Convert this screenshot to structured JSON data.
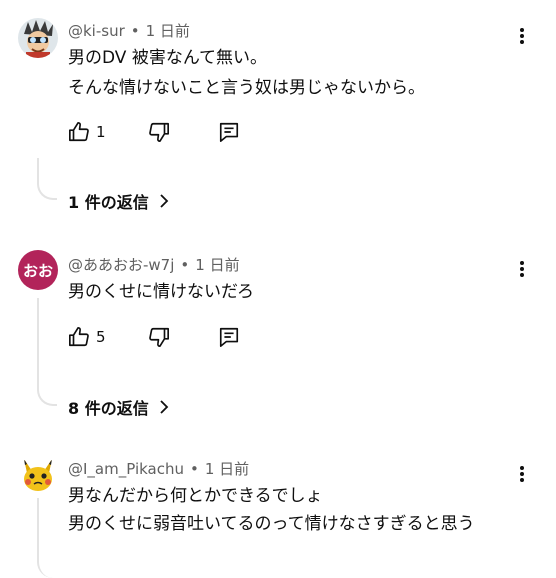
{
  "comments": [
    {
      "author": "@ki-sur",
      "separator": "•",
      "time": "1 日前",
      "lines": [
        "男のDV 被害なんて無い。",
        "そんな情けないこと言う奴は男じゃないから。"
      ],
      "likes": "1",
      "replies_label": "1 件の返信"
    },
    {
      "author": "@ああおお-w7j",
      "separator": "•",
      "time": "1 日前",
      "avatar_text": "おお",
      "avatar_color": "#b2245a",
      "lines": [
        "男のくせに情けないだろ"
      ],
      "likes": "5",
      "replies_label": "8 件の返信"
    },
    {
      "author": "@I_am_Pikachu",
      "separator": "•",
      "time": "1 日前",
      "lines": [
        "男なんだから何とかできるでしょ",
        "男のくせに弱音吐いてるのって情けなさすぎると思う"
      ]
    }
  ]
}
